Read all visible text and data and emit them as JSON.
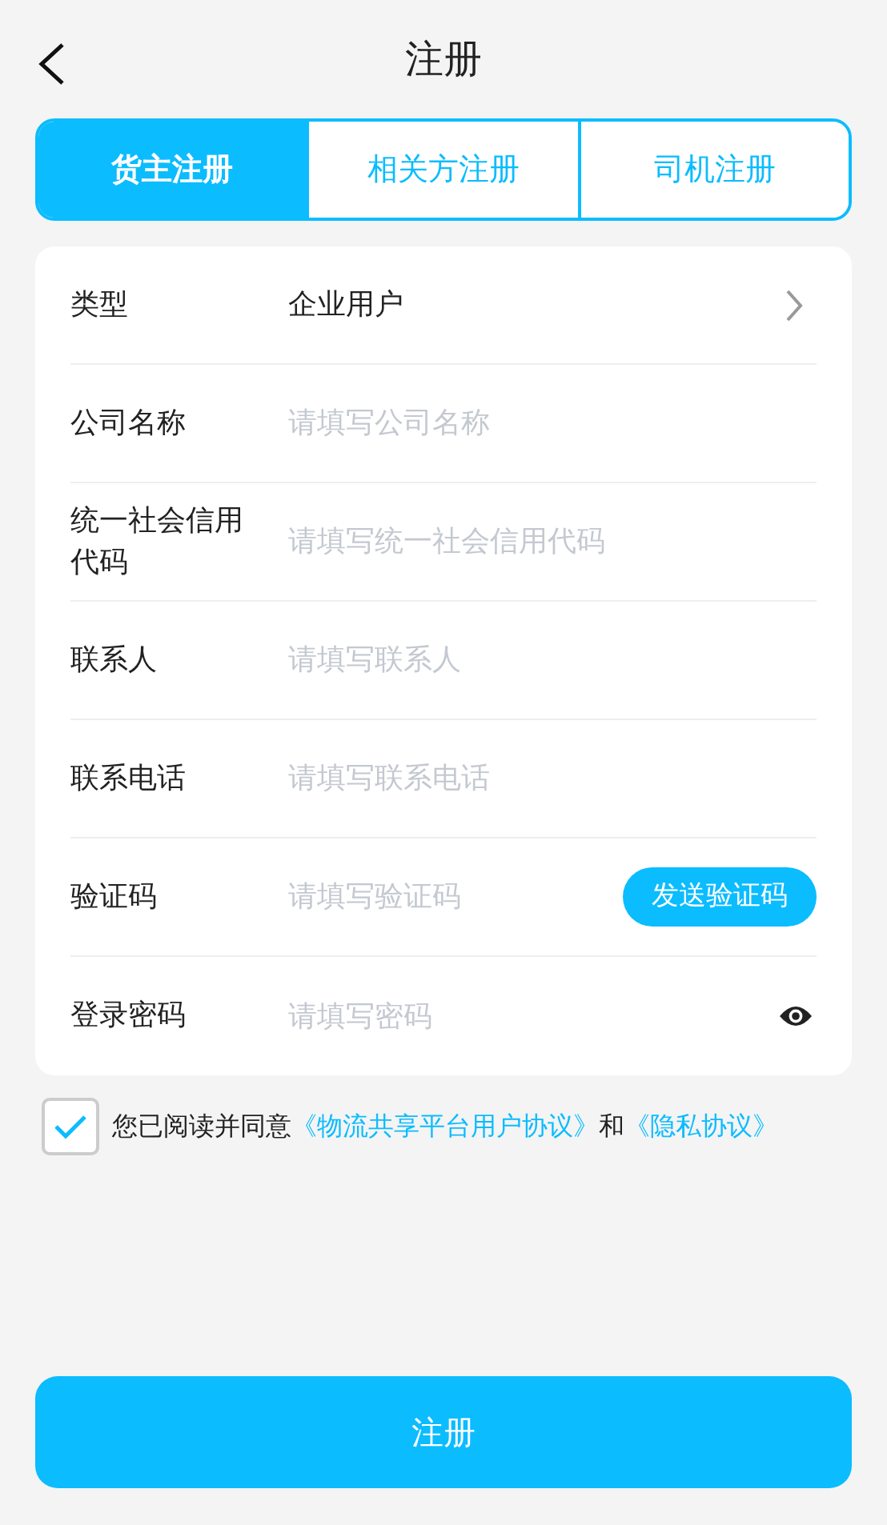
{
  "header": {
    "title": "注册"
  },
  "tabs": [
    {
      "label": "货主注册",
      "selected": true
    },
    {
      "label": "相关方注册",
      "selected": false
    },
    {
      "label": "司机注册",
      "selected": false
    }
  ],
  "fields": [
    {
      "kind": "select",
      "label": "类型",
      "value": "企业用户"
    },
    {
      "kind": "input",
      "label": "公司名称",
      "placeholder": "请填写公司名称"
    },
    {
      "kind": "input",
      "label": "统一社会信用代码",
      "placeholder": "请填写统一社会信用代码"
    },
    {
      "kind": "input",
      "label": "联系人",
      "placeholder": "请填写联系人"
    },
    {
      "kind": "input",
      "label": "联系电话",
      "placeholder": "请填写联系电话"
    },
    {
      "kind": "code",
      "label": "验证码",
      "placeholder": "请填写验证码",
      "button": "发送验证码"
    },
    {
      "kind": "password",
      "label": "登录密码",
      "placeholder": "请填写密码"
    }
  ],
  "agreement": {
    "checked": true,
    "text": "您已阅读并同意",
    "link_1": "《物流共享平台用户协议》",
    "joiner": "和",
    "link_2": "《隐私协议》"
  },
  "submit": "注册"
}
